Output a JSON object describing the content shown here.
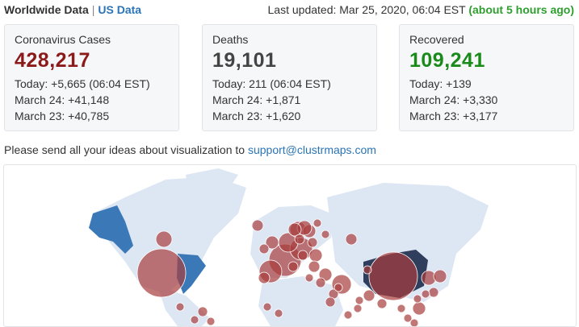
{
  "header": {
    "worldwide_label": "Worldwide Data",
    "separator": "|",
    "us_link": "US Data",
    "updated_label": "Last updated: Mar 25, 2020, 06:04 EST",
    "updated_ago": "(about 5 hours ago)"
  },
  "cards": [
    {
      "label": "Coronavirus Cases",
      "value": "428,217",
      "color": "#8b1a1a",
      "today": "Today: +5,665 (06:04 EST)",
      "mar24": "March 24: +41,148",
      "mar23": "March 23: +40,785"
    },
    {
      "label": "Deaths",
      "value": "19,101",
      "color": "#444444",
      "today": "Today: 211 (06:04 EST)",
      "mar24": "March 24: +1,871",
      "mar23": "March 23: +1,620"
    },
    {
      "label": "Recovered",
      "value": "109,241",
      "color": "#1a8a1a",
      "today": "Today: +139",
      "mar24": "March 24: +3,330",
      "mar23": "March 23: +3,177"
    }
  ],
  "message": {
    "text": "Please send all your ideas about visualization to ",
    "email": "support@clustrmaps.com"
  },
  "colors": {
    "link": "#2a74b5",
    "ago": "#2e9e2e",
    "land": "#dde6f3",
    "land_blue": "#3a78b8",
    "land_dark": "#2f3e5c",
    "bubble": "#a83d3d"
  }
}
